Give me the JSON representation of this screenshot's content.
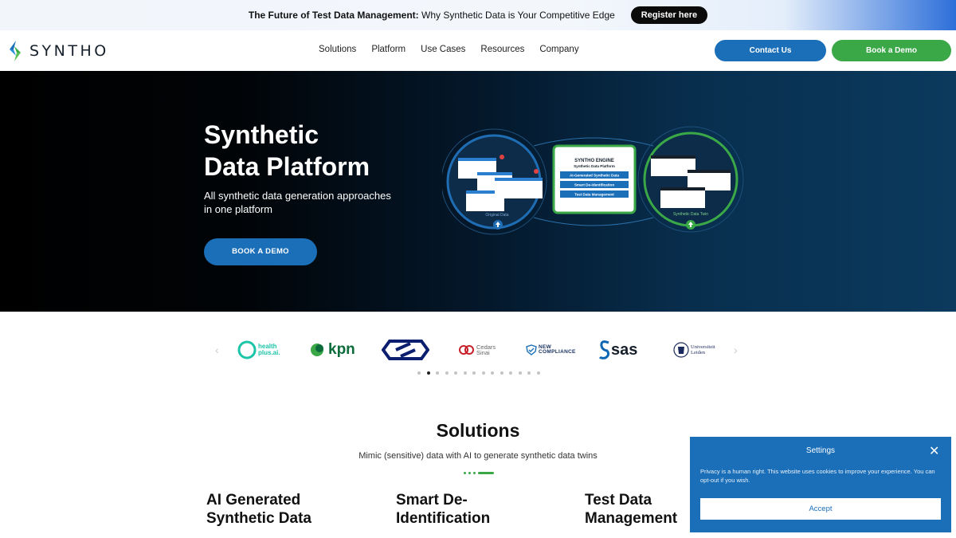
{
  "announcement": {
    "strong": "The Future of Test Data Management:",
    "text": " Why Synthetic Data is Your Competitive Edge",
    "button": "Register here"
  },
  "header": {
    "logo_text": "SYNTHO",
    "nav": [
      "Solutions",
      "Platform",
      "Use Cases",
      "Resources",
      "Company"
    ],
    "contact_label": "Contact Us",
    "demo_label": "Book a Demo"
  },
  "hero": {
    "title_line1": "Synthetic",
    "title_line2": "Data Platform",
    "subtitle": "All synthetic data generation approaches in one platform",
    "cta": "BOOK A DEMO",
    "graphic": {
      "engine_title": "SYNTHO ENGINE",
      "engine_sub": "Synthetic Data Platform",
      "features": [
        "AI-Generated Synthetic Data",
        "Smart De-Identification",
        "Test Data Management"
      ],
      "left_caption": "Original Data",
      "right_caption": "Synthetic Data Twin"
    }
  },
  "logos": {
    "items": [
      "health plus.ai",
      "kpn",
      "NS",
      "Cedars Sinai",
      "NEW COMPLIANCE",
      "sas",
      "Universiteit Leiden"
    ],
    "healthplus": [
      "health",
      "plus.ai."
    ],
    "cedars": [
      "Cedars",
      "Sinai"
    ],
    "newcompliance": [
      "NEW",
      "COMPLIANCE"
    ],
    "leiden": [
      "Universiteit",
      "Leiden"
    ],
    "carousel_active_index": 1,
    "carousel_count": 14
  },
  "solutions": {
    "title": "Solutions",
    "subtitle": "Mimic (sensitive) data with AI to generate synthetic data twins",
    "columns": [
      {
        "line1": "AI Generated",
        "line2": "Synthetic Data"
      },
      {
        "line1": "Smart De-",
        "line2": "Identification"
      },
      {
        "line1": "Test Data",
        "line2": "Management"
      }
    ]
  },
  "cookie": {
    "title": "Settings",
    "text": "Privacy is a human right. This website uses cookies to improve your experience. You can opt-out if you wish.",
    "accept": "Accept"
  },
  "colors": {
    "primary_blue": "#1a6fb8",
    "primary_green": "#3ba848"
  }
}
